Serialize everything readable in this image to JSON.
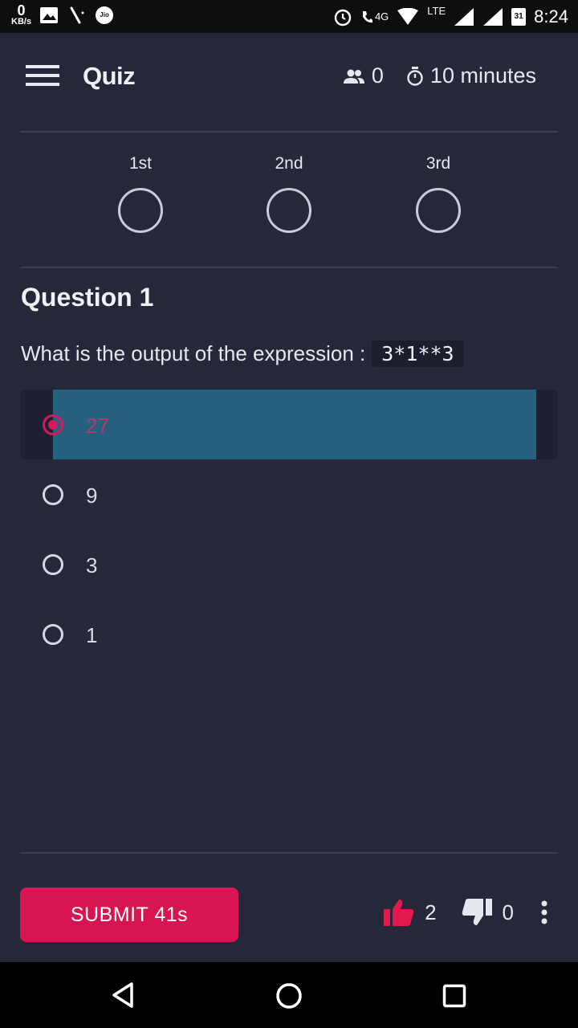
{
  "status_bar": {
    "net_speed_value": "0",
    "net_speed_unit": "KB/s",
    "carrier": "Jio",
    "network_4g": "4G",
    "lte": "LTE",
    "calendar_day": "31",
    "time": "8:24"
  },
  "header": {
    "title": "Quiz",
    "participants": "0",
    "duration": "10 minutes"
  },
  "leaderboard": [
    {
      "rank": "1st"
    },
    {
      "rank": "2nd"
    },
    {
      "rank": "3rd"
    }
  ],
  "question": {
    "title": "Question 1",
    "prompt": "What is the output of the expression :",
    "expression": "3*1**3"
  },
  "options": [
    {
      "label": "27",
      "selected": true
    },
    {
      "label": "9",
      "selected": false
    },
    {
      "label": "3",
      "selected": false
    },
    {
      "label": "1",
      "selected": false
    }
  ],
  "footer": {
    "submit_label": "SUBMIT 41s",
    "likes": "2",
    "dislikes": "0"
  },
  "colors": {
    "background": "#242838",
    "accent": "#d81552",
    "selected_fill": "#25607e"
  }
}
